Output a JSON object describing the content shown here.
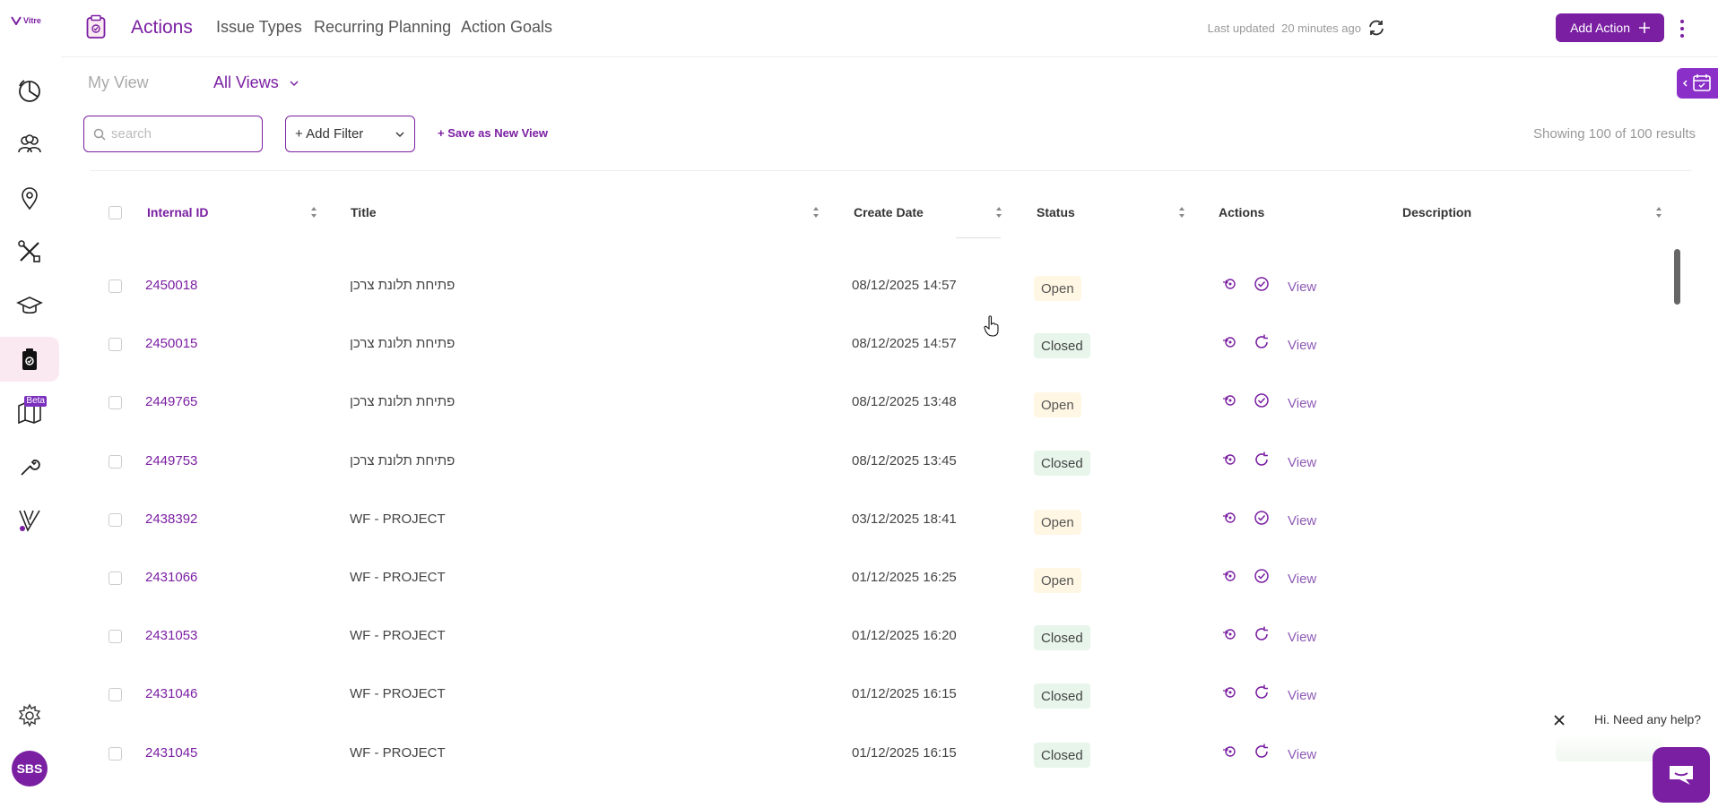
{
  "brand": {
    "logo_text": "Vitre"
  },
  "sidebar": {
    "items": [
      {
        "icon": "dashboard-icon"
      },
      {
        "icon": "users-icon"
      },
      {
        "icon": "location-icon"
      },
      {
        "icon": "tools-icon"
      },
      {
        "icon": "training-icon"
      },
      {
        "icon": "actions-clipboard-icon",
        "active": true
      },
      {
        "icon": "map-icon",
        "badge": "Beta"
      },
      {
        "icon": "wrench-icon"
      },
      {
        "icon": "vitre-icon"
      },
      {
        "icon": "settings-icon"
      }
    ],
    "avatar_initials": "SBS"
  },
  "header": {
    "tabs": [
      {
        "label": "Actions",
        "active": true
      },
      {
        "label": "Issue Types"
      },
      {
        "label": "Recurring Planning"
      },
      {
        "label": "Action Goals"
      }
    ],
    "last_updated_label": "Last updated",
    "last_updated_value": "20 minutes ago",
    "add_action_label": "Add Action"
  },
  "views": {
    "my_view_label": "My View",
    "all_views_label": "All Views"
  },
  "filters": {
    "search_placeholder": "search",
    "add_filter_label": "+ Add Filter",
    "save_view_label": "+ Save as New View",
    "results_text": "Showing 100 of 100 results"
  },
  "table": {
    "columns": [
      "Internal ID",
      "Title",
      "Create Date",
      "Status",
      "Actions",
      "Description"
    ],
    "view_label": "View",
    "rows": [
      {
        "id": "2450018",
        "title": "פתיחת תלונת צרכן",
        "date": "08/12/2025 14:57",
        "status": "Open"
      },
      {
        "id": "2450015",
        "title": "פתיחת תלונת צרכן",
        "date": "08/12/2025 14:57",
        "status": "Closed"
      },
      {
        "id": "2449765",
        "title": "פתיחת תלונת צרכן",
        "date": "08/12/2025 13:48",
        "status": "Open"
      },
      {
        "id": "2449753",
        "title": "פתיחת תלונת צרכן",
        "date": "08/12/2025 13:45",
        "status": "Closed"
      },
      {
        "id": "2438392",
        "title": "WF - PROJECT",
        "date": "03/12/2025 18:41",
        "status": "Open"
      },
      {
        "id": "2431066",
        "title": "WF - PROJECT",
        "date": "01/12/2025 16:25",
        "status": "Open"
      },
      {
        "id": "2431053",
        "title": "WF - PROJECT",
        "date": "01/12/2025 16:20",
        "status": "Closed"
      },
      {
        "id": "2431046",
        "title": "WF - PROJECT",
        "date": "01/12/2025 16:15",
        "status": "Closed"
      },
      {
        "id": "2431045",
        "title": "WF - PROJECT",
        "date": "01/12/2025 16:15",
        "status": "Closed"
      }
    ]
  },
  "help": {
    "text": "Hi. Need any help?"
  },
  "colors": {
    "accent": "#7a1fa2",
    "open_bg": "#fff7e3",
    "closed_bg": "#e7f5ea"
  }
}
